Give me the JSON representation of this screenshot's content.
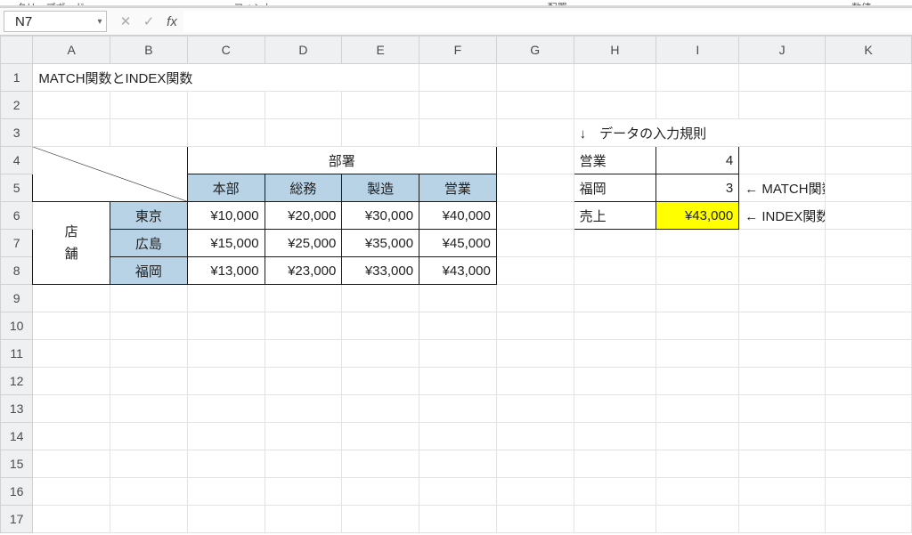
{
  "namebox": {
    "value": "N7"
  },
  "formula_bar": {
    "value": "",
    "placeholder": ""
  },
  "fx_label": "fx",
  "columns": [
    "",
    "A",
    "B",
    "C",
    "D",
    "E",
    "F",
    "G",
    "H",
    "I",
    "J",
    "K"
  ],
  "row_numbers": [
    "1",
    "2",
    "3",
    "4",
    "5",
    "6",
    "7",
    "8",
    "9",
    "10",
    "11",
    "12",
    "13",
    "14",
    "15",
    "16",
    "17"
  ],
  "title": "MATCH関数とINDEX関数",
  "bushou_label": "部署",
  "bushou_cols": [
    "本部",
    "総務",
    "製造",
    "営業"
  ],
  "tenpo_label_1": "店",
  "tenpo_label_2": "舗",
  "tenpo_rows": [
    "東京",
    "広島",
    "福岡"
  ],
  "price_rows": [
    [
      "¥10,000",
      "¥20,000",
      "¥30,000",
      "¥40,000"
    ],
    [
      "¥15,000",
      "¥25,000",
      "¥35,000",
      "¥45,000"
    ],
    [
      "¥13,000",
      "¥23,000",
      "¥33,000",
      "¥43,000"
    ]
  ],
  "lookup": {
    "hint": "↓　データの入力規則",
    "rows": [
      {
        "k": "営業",
        "v": "4"
      },
      {
        "k": "福岡",
        "v": "3"
      },
      {
        "k": "売上",
        "v": "¥43,000"
      }
    ],
    "note1": "← MATCH関数",
    "note2": "← INDEX関数"
  },
  "ribbon_groups": [
    "クリップボード",
    "",
    "フォント",
    "",
    "",
    "配置",
    "",
    "",
    "数値"
  ]
}
